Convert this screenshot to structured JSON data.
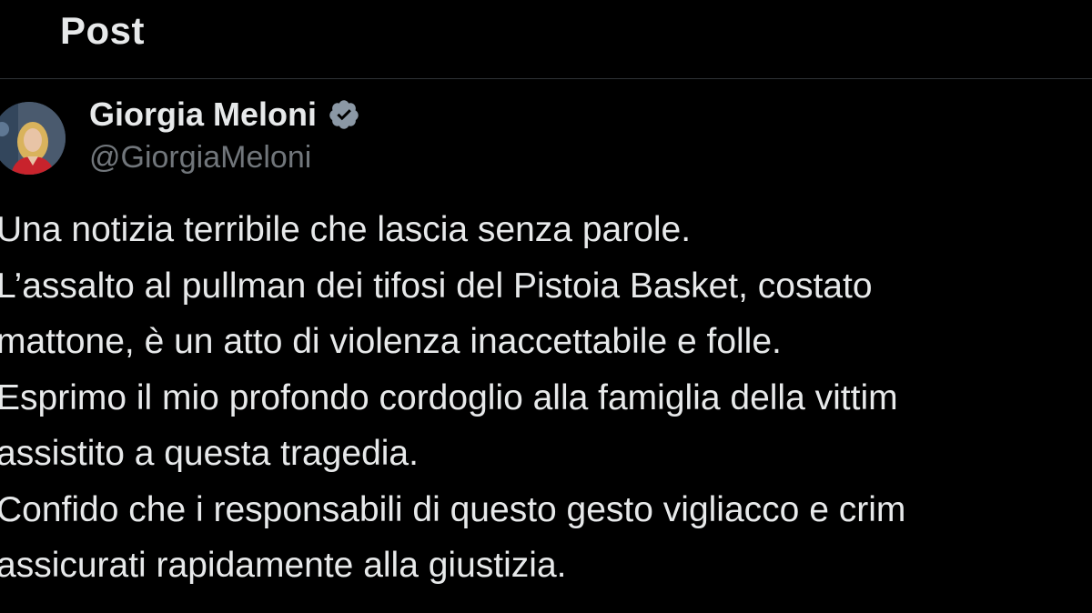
{
  "header": {
    "title": "Post"
  },
  "author": {
    "name": "Giorgia Meloni",
    "handle": "@GiorgiaMeloni",
    "verified_color": "#1d9bf0",
    "avatar_icon": "profile-photo-avatar"
  },
  "tweet": {
    "lines": [
      "Una notizia terribile che lascia senza parole.",
      "L’assalto al pullman dei tifosi del Pistoia Basket, costato",
      "mattone, è un atto di violenza inaccettabile e folle.",
      "Esprimo il mio profondo cordoglio alla famiglia della vittim",
      "assistito a questa tragedia.",
      "Confido che i responsabili di questo gesto vigliacco e crim",
      "assicurati rapidamente alla giustizia."
    ]
  },
  "colors": {
    "background": "#000000",
    "text_primary": "#e7e9ea",
    "text_secondary": "#71767b",
    "divider": "#2f3336"
  }
}
